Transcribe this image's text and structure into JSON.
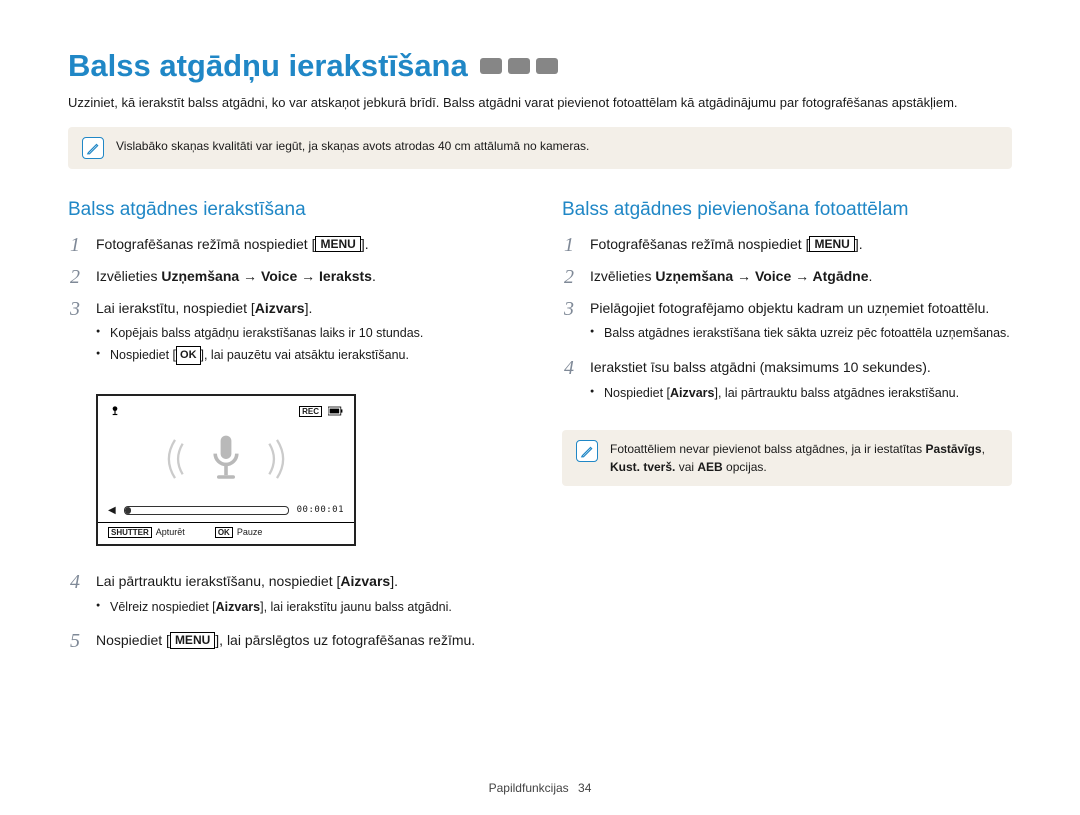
{
  "title": "Balss atgādņu ierakstīšana",
  "intro": "Uzziniet, kā ierakstīt balss atgādni, ko var atskaņot jebkurā brīdī. Balss atgādni varat pievienot fotoattēlam kā atgādinājumu par fotografēšanas apstākļiem.",
  "callout_top": "Vislabāko skaņas kvalitāti var iegūt, ja skaņas avots atrodas 40 cm attālumā no kameras.",
  "left": {
    "heading": "Balss atgādnes ierakstīšana",
    "step1_pre": "Fotografēšanas režīmā nospiediet [",
    "step1_btn": "MENU",
    "step1_post": "].",
    "step2_pre": "Izvēlieties ",
    "step2_bold": "Uzņemšana → Voice → Ieraksts",
    "step2_post": ".",
    "step3_pre": "Lai ierakstītu, nospiediet [",
    "step3_bold": "Aizvars",
    "step3_post": "].",
    "step3_li1": "Kopējais balss atgādņu ierakstīšanas laiks ir 10 stundas.",
    "step3_li2_pre": "Nospiediet [",
    "step3_li2_btn": "OK",
    "step3_li2_post": "], lai pauzētu vai atsāktu ierakstīšanu.",
    "step4_pre": "Lai pārtrauktu ierakstīšanu, nospiediet [",
    "step4_bold": "Aizvars",
    "step4_post": "].",
    "step4_li_pre": "Vēlreiz nospiediet [",
    "step4_li_bold": "Aizvars",
    "step4_li_post": "], lai ierakstītu jaunu balss atgādni.",
    "step5_pre": "Nospiediet [",
    "step5_btn": "MENU",
    "step5_post": "], lai pārslēgtos uz fotografēšanas režīmu."
  },
  "right": {
    "heading": "Balss atgādnes pievienošana fotoattēlam",
    "step1_pre": "Fotografēšanas režīmā nospiediet [",
    "step1_btn": "MENU",
    "step1_post": "].",
    "step2_pre": "Izvēlieties ",
    "step2_bold": "Uzņemšana → Voice → Atgādne",
    "step2_post": ".",
    "step3": "Pielāgojiet fotografējamo objektu kadram un uzņemiet fotoattēlu.",
    "step3_li": "Balss atgādnes ierakstīšana tiek sākta uzreiz pēc fotoattēla uzņemšanas.",
    "step4": "Ierakstiet īsu balss atgādni (maksimums 10 sekundes).",
    "step4_li_pre": "Nospiediet [",
    "step4_li_bold": "Aizvars",
    "step4_li_post": "], lai pārtrauktu balss atgādnes ierakstīšanu.",
    "callout_pre": "Fotoattēliem nevar pievienot balss atgādnes, ja ir iestatītas ",
    "callout_b1": "Pastāvīgs",
    "callout_mid": ", ",
    "callout_b2": "Kust. tverš.",
    "callout_mid2": " vai ",
    "callout_b3": "AEB",
    "callout_post": " opcijas."
  },
  "panel": {
    "rec_label": "REC",
    "time": "00:00:01",
    "shutter_tag": "SHUTTER",
    "stop": "Apturēt",
    "ok_tag": "OK",
    "pause": "Pauze"
  },
  "footer_label": "Papildfunkcijas",
  "footer_page": "34"
}
